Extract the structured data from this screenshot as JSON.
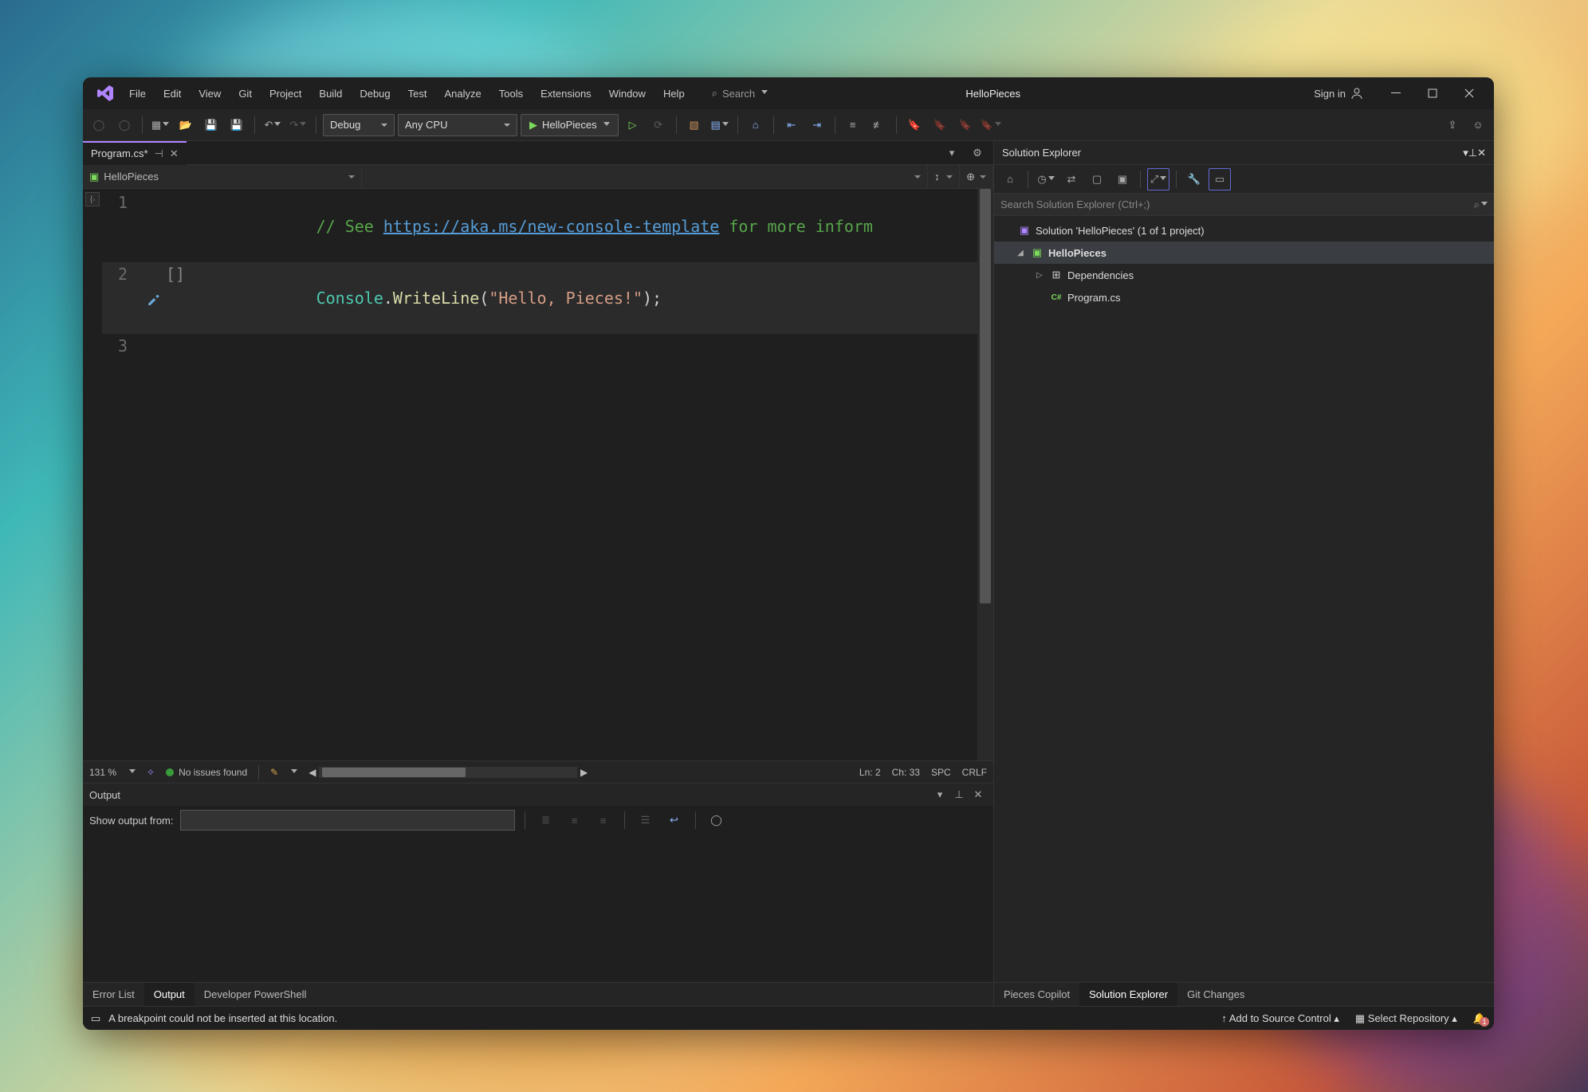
{
  "app": {
    "title": "HelloPieces",
    "signin": "Sign in"
  },
  "menu": [
    "File",
    "Edit",
    "View",
    "Git",
    "Project",
    "Build",
    "Debug",
    "Test",
    "Analyze",
    "Tools",
    "Extensions",
    "Window",
    "Help"
  ],
  "search": {
    "label": "Search"
  },
  "toolbar": {
    "config": "Debug",
    "platform": "Any CPU",
    "start": "HelloPieces"
  },
  "tab": {
    "name": "Program.cs*",
    "dirty": true
  },
  "nav": {
    "project": "HelloPieces"
  },
  "code": {
    "lines": [
      {
        "n": 1
      },
      {
        "n": 2
      },
      {
        "n": 3
      }
    ],
    "comment_prefix": "// See ",
    "url": "https://aka.ms/new-console-template",
    "comment_suffix": " for more inform",
    "cls": "Console",
    "dot": ".",
    "method": "WriteLine",
    "open": "(",
    "str": "\"Hello, Pieces!\"",
    "close": ");"
  },
  "editorStatus": {
    "zoom": "131 %",
    "issues": "No issues found",
    "ln": "Ln: 2",
    "ch": "Ch: 33",
    "spc": "SPC",
    "eol": "CRLF"
  },
  "output": {
    "title": "Output",
    "from_label": "Show output from:"
  },
  "bottomTabs": {
    "errorList": "Error List",
    "output": "Output",
    "devps": "Developer PowerShell"
  },
  "rightBottomTabs": {
    "copilot": "Pieces Copilot",
    "sx": "Solution Explorer",
    "git": "Git Changes"
  },
  "sx": {
    "title": "Solution Explorer",
    "search_placeholder": "Search Solution Explorer (Ctrl+;)",
    "solution": "Solution 'HelloPieces' (1 of 1 project)",
    "project": "HelloPieces",
    "deps": "Dependencies",
    "file": "Program.cs"
  },
  "status": {
    "msg": "A breakpoint could not be inserted at this location.",
    "addSource": "Add to Source Control",
    "selectRepo": "Select Repository"
  }
}
